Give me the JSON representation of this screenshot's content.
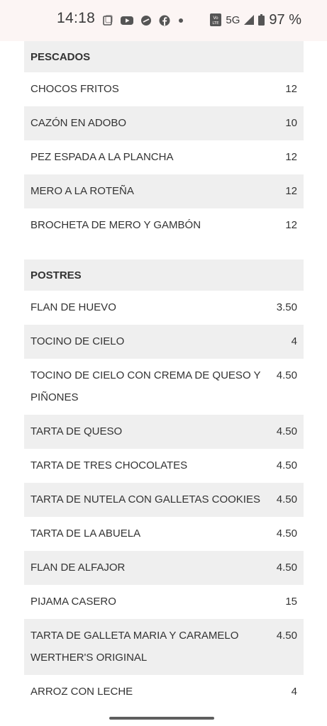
{
  "status_bar": {
    "time": "14:18",
    "network": "5G",
    "volte": "Vo LTE",
    "battery": "97 %",
    "icons_left": [
      "screenshot-icon",
      "youtube-icon",
      "app-icon",
      "facebook-icon",
      "dot-icon"
    ],
    "icons_right": [
      "volte-icon",
      "signal-icon",
      "battery-icon"
    ]
  },
  "sections": [
    {
      "title": "PESCADOS",
      "items": [
        {
          "name": "CHOCOS FRITOS",
          "price": "12"
        },
        {
          "name": "CAZÓN EN ADOBO",
          "price": "10"
        },
        {
          "name": "PEZ ESPADA A LA PLANCHA",
          "price": "12"
        },
        {
          "name": "MERO A LA ROTEÑA",
          "price": "12"
        },
        {
          "name": "BROCHETA DE MERO Y GAMBÓN",
          "price": "12"
        }
      ]
    },
    {
      "title": "POSTRES",
      "items": [
        {
          "name": "FLAN DE HUEVO",
          "price": "3.50"
        },
        {
          "name": "TOCINO DE CIELO",
          "price": "4"
        },
        {
          "name": "TOCINO DE CIELO CON CREMA DE QUESO Y PIÑONES",
          "price": "4.50"
        },
        {
          "name": "TARTA DE QUESO",
          "price": "4.50"
        },
        {
          "name": "TARTA DE TRES CHOCOLATES",
          "price": "4.50"
        },
        {
          "name": "TARTA DE NUTELA CON GALLETAS COOKIES",
          "price": "4.50"
        },
        {
          "name": "TARTA DE LA ABUELA",
          "price": "4.50"
        },
        {
          "name": "FLAN DE ALFAJOR",
          "price": "4.50"
        },
        {
          "name": "PIJAMA CASERO",
          "price": "15"
        },
        {
          "name": "TARTA DE GALLETA MARIA Y CARAMELO WERTHER'S ORIGINAL",
          "price": "4.50"
        },
        {
          "name": "ARROZ CON LECHE",
          "price": "4"
        }
      ]
    }
  ],
  "colors": {
    "status_bar_bg": "#fcf5f4",
    "row_shade": "#efefef",
    "text": "#333333"
  }
}
